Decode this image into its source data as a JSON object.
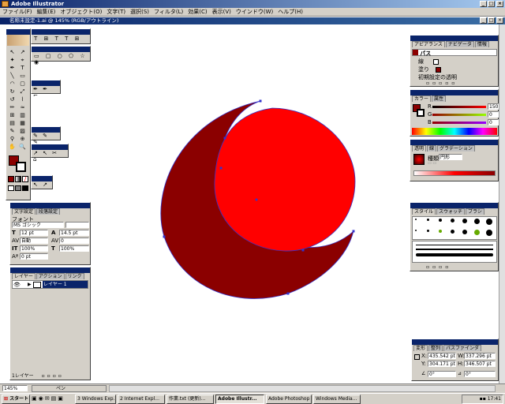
{
  "app": {
    "title": "Adobe Illustrator"
  },
  "menu": [
    "ファイル(F)",
    "編集(E)",
    "オブジェクト(O)",
    "文字(T)",
    "選択(S)",
    "フィルタ(L)",
    "効果(C)",
    "表示(V)",
    "ウインドウ(W)",
    "ヘルプ(H)"
  ],
  "document": {
    "title": "名称未設定-1.ai @ 145% (RGB/アウトライン)"
  },
  "appearance": {
    "tabs": [
      "アピアランス",
      "ナビゲータ",
      "情報"
    ],
    "object": "パス",
    "stroke_label": "線",
    "fill_label": "塗り",
    "default_label": "初期設定の透明"
  },
  "color": {
    "tabs": [
      "カラー",
      "属性"
    ],
    "r_label": "R",
    "r_value": "150",
    "g_label": "G",
    "g_value": "0",
    "b_label": "B",
    "b_value": "0"
  },
  "gradient": {
    "tabs": [
      "透明",
      "線",
      "グラデーション"
    ],
    "type_label": "種類",
    "type_value": "円形"
  },
  "styles": {
    "tabs": [
      "スタイル",
      "スウォッチ",
      "ブラシ"
    ],
    "brush_sizes": [
      "1",
      "3",
      "5",
      "9",
      "13",
      "19",
      "5",
      "9",
      "13",
      "17",
      "21",
      "27",
      "35",
      "45",
      "65",
      "100",
      "200",
      "300",
      "25",
      "50"
    ]
  },
  "transform": {
    "tabs": [
      "変形",
      "整列",
      "パスファインダ"
    ],
    "x_label": "X:",
    "x_value": "435.542 pt",
    "y_label": "Y:",
    "y_value": "304.171 pt",
    "w_label": "W:",
    "w_value": "337.296 pt",
    "h_label": "H:",
    "h_value": "346.507 pt",
    "angle_value": "0°",
    "shear_value": "0°"
  },
  "character": {
    "tabs": [
      "文字設定",
      "段落設定"
    ],
    "font_label": "フォント",
    "font_value": "MS ゴシック",
    "size_value": "12 pt",
    "leading_value": "14.5 pt",
    "kerning_value": "自動",
    "tracking_value": "0",
    "vscale_value": "100%",
    "hscale_value": "100%",
    "baseline_value": "0 pt"
  },
  "layers": {
    "tabs": [
      "レイヤー",
      "アクション",
      "リンク"
    ],
    "layer_name": "レイヤー 1",
    "footer_label": "1レイヤー"
  },
  "status": {
    "zoom": "145%",
    "tool": "ペン"
  },
  "taskbar": {
    "start": "スタート",
    "buttons": [
      "3 Windows Exp...",
      "2 Internet Expl...",
      "作業.txt (更新)...",
      "Adobe Illustr...",
      "Adobe Photoshop",
      "Windows Media..."
    ],
    "clock": "17:41"
  },
  "artwork": {
    "crescent_color": "#8b0000",
    "circle_color": "#ff0000",
    "path_color": "#3333cc"
  }
}
